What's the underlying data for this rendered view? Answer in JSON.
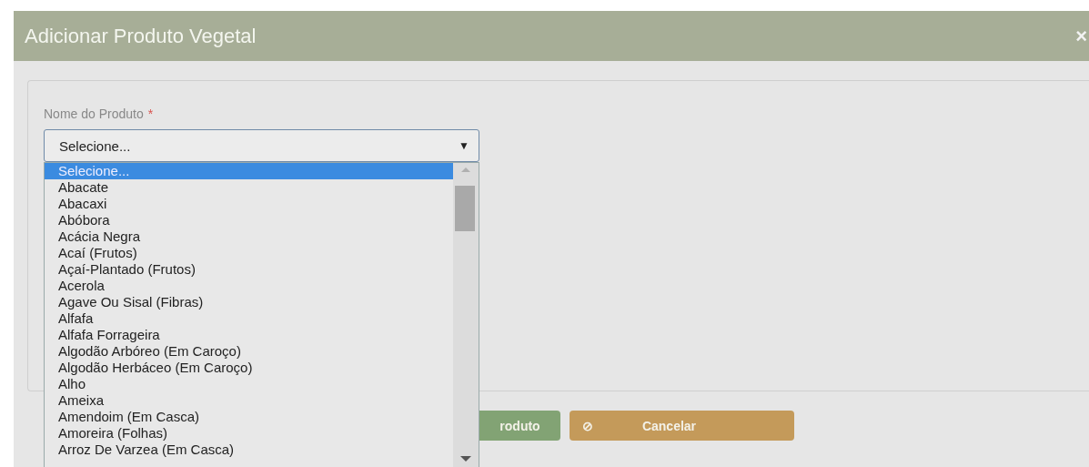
{
  "dialog": {
    "title": "Adicionar Produto Vegetal",
    "close": "×"
  },
  "field": {
    "label": "Nome do Produto",
    "required_mark": "*",
    "value": "Selecione...",
    "arrow": "▼"
  },
  "options": [
    {
      "label": "Selecione...",
      "selected": true
    },
    {
      "label": "Abacate",
      "selected": false
    },
    {
      "label": "Abacaxi",
      "selected": false
    },
    {
      "label": "Abóbora",
      "selected": false
    },
    {
      "label": "Acácia Negra",
      "selected": false
    },
    {
      "label": "Acaí (Frutos)",
      "selected": false
    },
    {
      "label": "Açaí-Plantado (Frutos)",
      "selected": false
    },
    {
      "label": "Acerola",
      "selected": false
    },
    {
      "label": "Agave Ou Sisal (Fibras)",
      "selected": false
    },
    {
      "label": "Alfafa",
      "selected": false
    },
    {
      "label": "Alfafa Forrageira",
      "selected": false
    },
    {
      "label": "Algodão Arbóreo (Em Caroço)",
      "selected": false
    },
    {
      "label": "Algodão Herbáceo (Em Caroço)",
      "selected": false
    },
    {
      "label": "Alho",
      "selected": false
    },
    {
      "label": "Ameixa",
      "selected": false
    },
    {
      "label": "Amendoim (Em Casca)",
      "selected": false
    },
    {
      "label": "Amoreira (Folhas)",
      "selected": false
    },
    {
      "label": "Arroz De Varzea (Em Casca)",
      "selected": false
    }
  ],
  "buttons": [
    {
      "kind": "save",
      "label": "roduto"
    },
    {
      "kind": "cancel",
      "icon": "⊘",
      "label": "Cancelar"
    }
  ]
}
